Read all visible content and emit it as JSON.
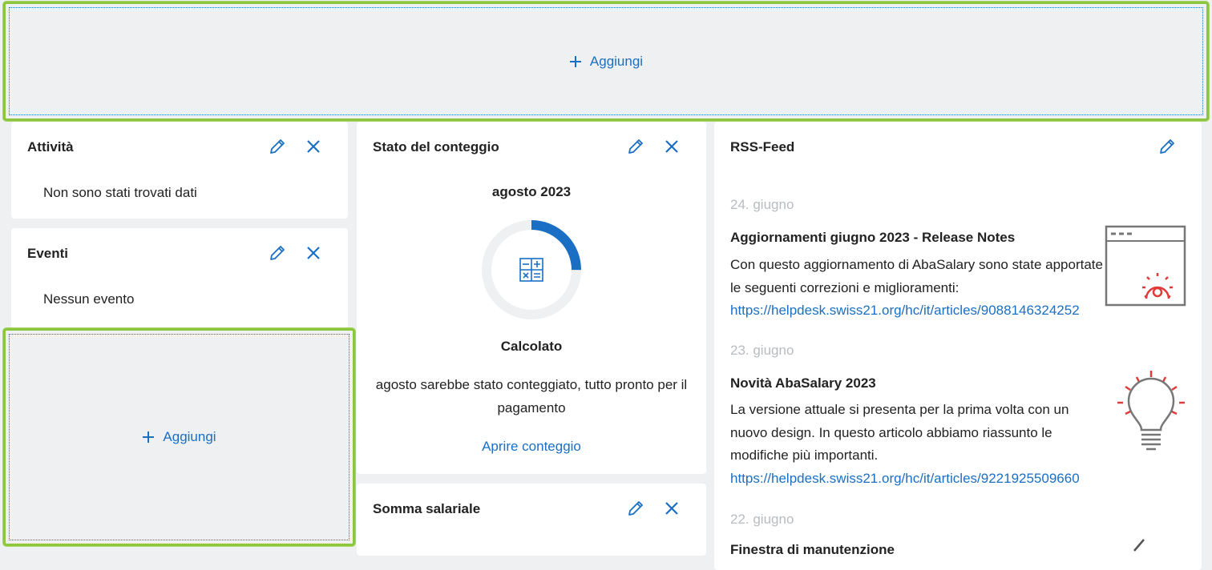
{
  "colors": {
    "accent": "#1a6fc4",
    "highlight": "#8cc63f",
    "background": "#eef0f2",
    "alert_red": "#e03a3a",
    "muted": "#b8bcc0"
  },
  "top_zone": {
    "add_label": "Aggiungi"
  },
  "left_zone": {
    "add_label": "Aggiungi"
  },
  "attivita": {
    "title": "Attività",
    "empty_text": "Non sono stati trovati dati"
  },
  "eventi": {
    "title": "Eventi",
    "empty_text": "Nessun evento"
  },
  "stato": {
    "title": "Stato del conteggio",
    "period": "agosto 2023",
    "progress_fraction": 0.25,
    "status": "Calcolato",
    "description": "agosto sarebbe stato conteggiato, tutto pronto per il pagamento",
    "link_label": "Aprire conteggio"
  },
  "somma": {
    "title": "Somma salariale"
  },
  "rss": {
    "title": "RSS-Feed",
    "items": [
      {
        "date": "24. giugno",
        "title": "Aggiornamenti giugno 2023 - Release Notes",
        "body": "Con questo aggiornamento di AbaSalary sono state apportate le seguenti correzioni e miglioramenti:",
        "link": "https://helpdesk.swiss21.org/hc/it/articles/9088146324252",
        "icon": "browser-gear-icon"
      },
      {
        "date": "23. giugno",
        "title": "Novità AbaSalary 2023",
        "body": "La versione attuale si presenta per la prima volta con un nuovo design. In questo articolo abbiamo riassunto le modifiche più importanti.",
        "link": "https://helpdesk.swiss21.org/hc/it/articles/9221925509660",
        "icon": "lightbulb-icon"
      },
      {
        "date": "22. giugno",
        "title": "Finestra di manutenzione"
      }
    ]
  }
}
